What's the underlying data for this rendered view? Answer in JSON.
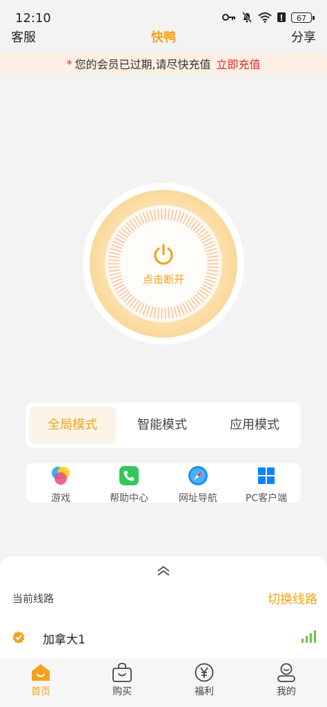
{
  "status": {
    "time": "12:10",
    "battery": "67"
  },
  "header": {
    "left": "客服",
    "title": "快鸭",
    "right": "分享"
  },
  "notice": {
    "star": "*",
    "message": "您的会员已过期,请尽快充值",
    "action": "立即充值"
  },
  "power": {
    "label": "点击断开"
  },
  "modes": [
    {
      "label": "全局模式",
      "active": true
    },
    {
      "label": "智能模式",
      "active": false
    },
    {
      "label": "应用模式",
      "active": false
    }
  ],
  "quick": [
    {
      "label": "游戏",
      "icon": "game-icon"
    },
    {
      "label": "帮助中心",
      "icon": "phone-icon"
    },
    {
      "label": "网址导航",
      "icon": "compass-icon"
    },
    {
      "label": "PC客户端",
      "icon": "windows-icon"
    }
  ],
  "route": {
    "current_label": "当前线路",
    "switch": "切换线路",
    "name": "加拿大1"
  },
  "tabs": [
    {
      "label": "首页",
      "icon": "home-icon",
      "active": true
    },
    {
      "label": "购买",
      "icon": "bag-icon",
      "active": false
    },
    {
      "label": "福利",
      "icon": "yen-icon",
      "active": false
    },
    {
      "label": "我的",
      "icon": "profile-icon",
      "active": false
    }
  ],
  "colors": {
    "accent": "#f4a21a",
    "alert": "#e0272b",
    "notice_bg": "#fcefe4",
    "signal": "#6cc04a"
  }
}
